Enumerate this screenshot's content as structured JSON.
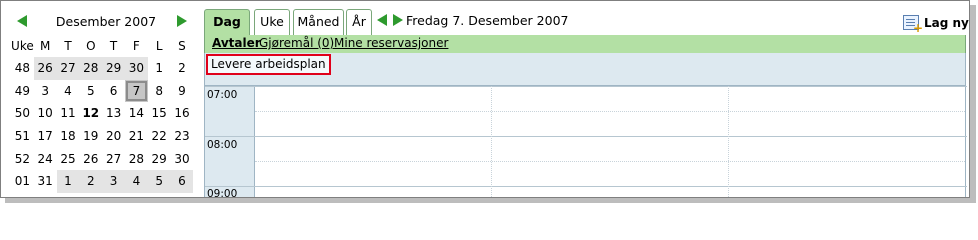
{
  "mini_calendar": {
    "title": "Desember 2007",
    "prev_icon": "green-arrow-left-icon",
    "next_icon": "green-arrow-right-icon",
    "week_header": "Uke",
    "weekdays": [
      "M",
      "T",
      "O",
      "T",
      "F",
      "L",
      "S"
    ],
    "weeks": [
      {
        "week": "48",
        "days": [
          "26",
          "27",
          "28",
          "29",
          "30",
          "1",
          "2"
        ]
      },
      {
        "week": "49",
        "days": [
          "3",
          "4",
          "5",
          "6",
          "7",
          "8",
          "9"
        ]
      },
      {
        "week": "50",
        "days": [
          "10",
          "11",
          "12",
          "13",
          "14",
          "15",
          "16"
        ]
      },
      {
        "week": "51",
        "days": [
          "17",
          "18",
          "19",
          "20",
          "21",
          "22",
          "23"
        ]
      },
      {
        "week": "52",
        "days": [
          "24",
          "25",
          "26",
          "27",
          "28",
          "29",
          "30"
        ]
      },
      {
        "week": "01",
        "days": [
          "31",
          "1",
          "2",
          "3",
          "4",
          "5",
          "6"
        ]
      }
    ],
    "selected_day": "7",
    "today_day": "12"
  },
  "view_tabs": [
    {
      "label": "Dag",
      "active": true
    },
    {
      "label": "Uke",
      "active": false
    },
    {
      "label": "Måned",
      "active": false
    },
    {
      "label": "År",
      "active": false
    }
  ],
  "current_date": "Fredag 7. Desember 2007",
  "new_button": {
    "label": "Lag ny",
    "icon": "new-document-icon"
  },
  "subtabs": [
    {
      "label": "Avtaler",
      "active": true
    },
    {
      "label": "Gjøremål (0)",
      "active": false
    },
    {
      "label": "Mine reservasjoner",
      "active": false
    }
  ],
  "allday_event": {
    "label": "Levere arbeidsplan"
  },
  "time_slots": [
    "07:00",
    "08:00",
    "09:00"
  ],
  "colors": {
    "tab_active": "#b3e0a4",
    "grid_background": "#dde9f0",
    "event_border": "#e0001a",
    "arrow": "#2e9a2e"
  }
}
